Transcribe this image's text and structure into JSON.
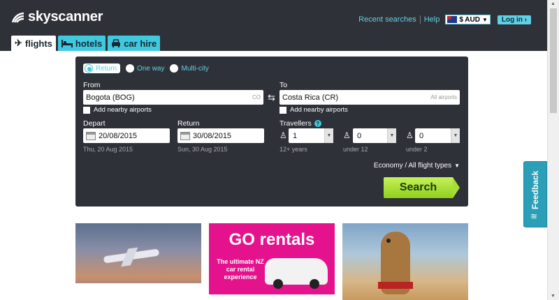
{
  "brand": {
    "name": "skyscanner"
  },
  "header": {
    "recent_searches": "Recent searches",
    "help": "Help",
    "currency": "$ AUD",
    "login": "Log in ›"
  },
  "tabs": [
    {
      "label": "flights",
      "icon": "plane-icon",
      "active": true
    },
    {
      "label": "hotels",
      "icon": "bed-icon",
      "active": false
    },
    {
      "label": "car hire",
      "icon": "car-icon",
      "active": false
    }
  ],
  "search": {
    "trip_types": [
      "Return",
      "One way",
      "Multi-city"
    ],
    "selected_trip_type": "Return",
    "from_label": "From",
    "from_value": "Bogota (BOG)",
    "from_hint": "CO",
    "to_label": "To",
    "to_value": "Costa Rica (CR)",
    "to_hint": "All airports",
    "nearby_label": "Add nearby airports",
    "depart_label": "Depart",
    "depart_value": "20/08/2015",
    "depart_sub": "Thu, 20 Aug 2015",
    "return_label": "Return",
    "return_value": "30/08/2015",
    "return_sub": "Sun, 30 Aug 2015",
    "travellers_label": "Travellers",
    "adults_value": "1",
    "adults_sub": "12+ years",
    "children_value": "0",
    "children_sub": "under 12",
    "infants_value": "0",
    "infants_sub": "under 2",
    "cabin": "Economy / All flight types",
    "search_button": "Search"
  },
  "feedback": {
    "label": "Feedback"
  },
  "cards": {
    "rentals_logo": "GO rentals",
    "rentals_tagline": "The ultimate NZ car rental experience"
  },
  "colors": {
    "accent": "#3ec9df",
    "header_bg": "#2f3138",
    "search_green": "#a7de34",
    "rentals_pink": "#e5128d"
  }
}
